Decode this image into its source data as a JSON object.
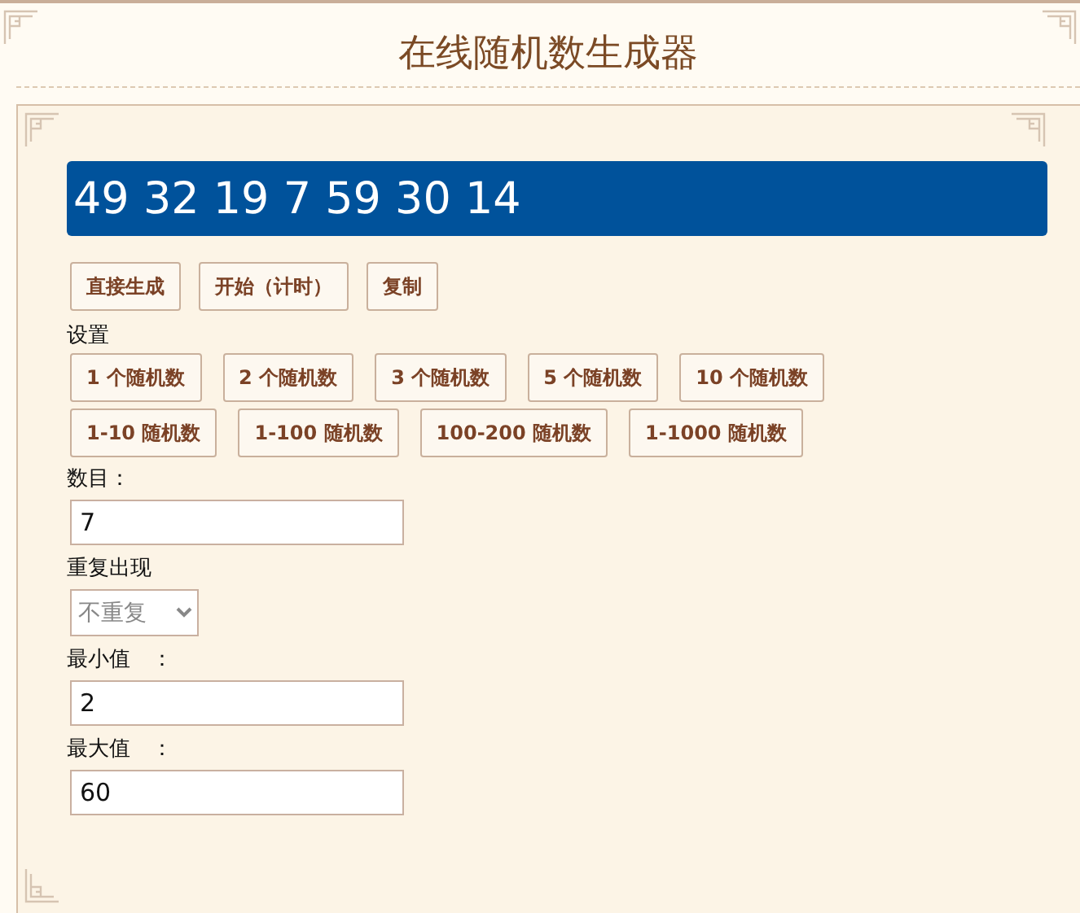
{
  "title": "在线随机数生成器",
  "result": "49 32 19 7 59 30 14",
  "actions": [
    "直接生成",
    "开始（计时）",
    "复制"
  ],
  "settings_label": "设置",
  "preset_rows": [
    [
      "1 个随机数",
      "2 个随机数",
      "3 个随机数",
      "5 个随机数",
      "10 个随机数"
    ],
    [
      "1-10 随机数",
      "1-100 随机数",
      "100-200 随机数",
      "1-1000 随机数"
    ]
  ],
  "fields": [
    {
      "kind": "text",
      "label": "数目：",
      "value": "7"
    },
    {
      "kind": "select",
      "label": "重复出现",
      "value": "不重复"
    },
    {
      "kind": "text",
      "label": "最小值　：",
      "value": "2"
    },
    {
      "kind": "text",
      "label": "最大值　：",
      "value": "60"
    }
  ]
}
